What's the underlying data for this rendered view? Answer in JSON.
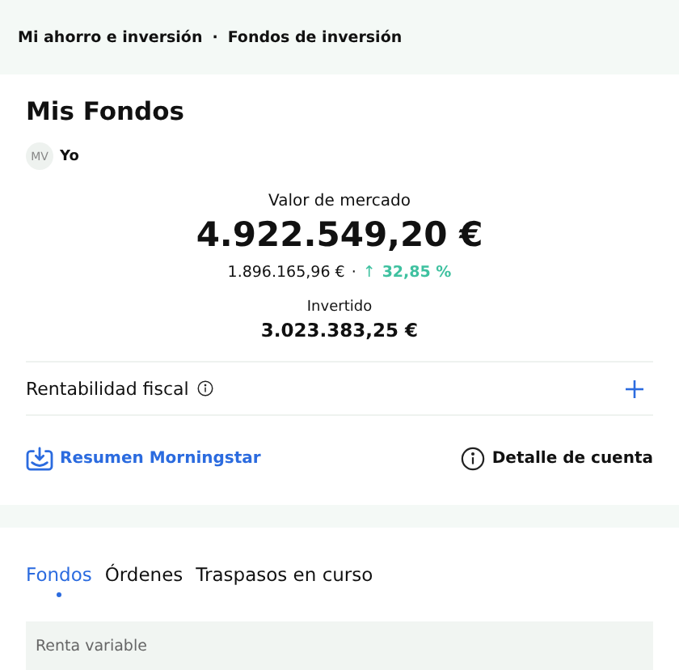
{
  "breadcrumb": [
    {
      "label": "Mi ahorro e inversión"
    },
    {
      "label": "Fondos de inversión"
    }
  ],
  "breadcrumb_separator": "·",
  "title": "Mis Fondos",
  "owner": {
    "initials": "MV",
    "name": "Yo"
  },
  "market_value": {
    "label": "Valor de mercado",
    "value": "4.922.549,20 €",
    "gain": "1.896.165,96 €",
    "separator": "·",
    "arrow": "↑",
    "percent": "32,85 %"
  },
  "invested": {
    "label": "Invertido",
    "value": "3.023.383,25 €"
  },
  "fiscal": {
    "label": "Rentabilidad fiscal",
    "expanded": false
  },
  "actions": [
    {
      "kind": "download",
      "label": "Resumen Morningstar"
    },
    {
      "kind": "info",
      "label": "Detalle de cuenta"
    }
  ],
  "tabs": [
    {
      "label": "Fondos",
      "selected": true
    },
    {
      "label": "Órdenes",
      "selected": false
    },
    {
      "label": "Traspasos en curso",
      "selected": false
    }
  ],
  "section": {
    "label": "Renta variable"
  }
}
